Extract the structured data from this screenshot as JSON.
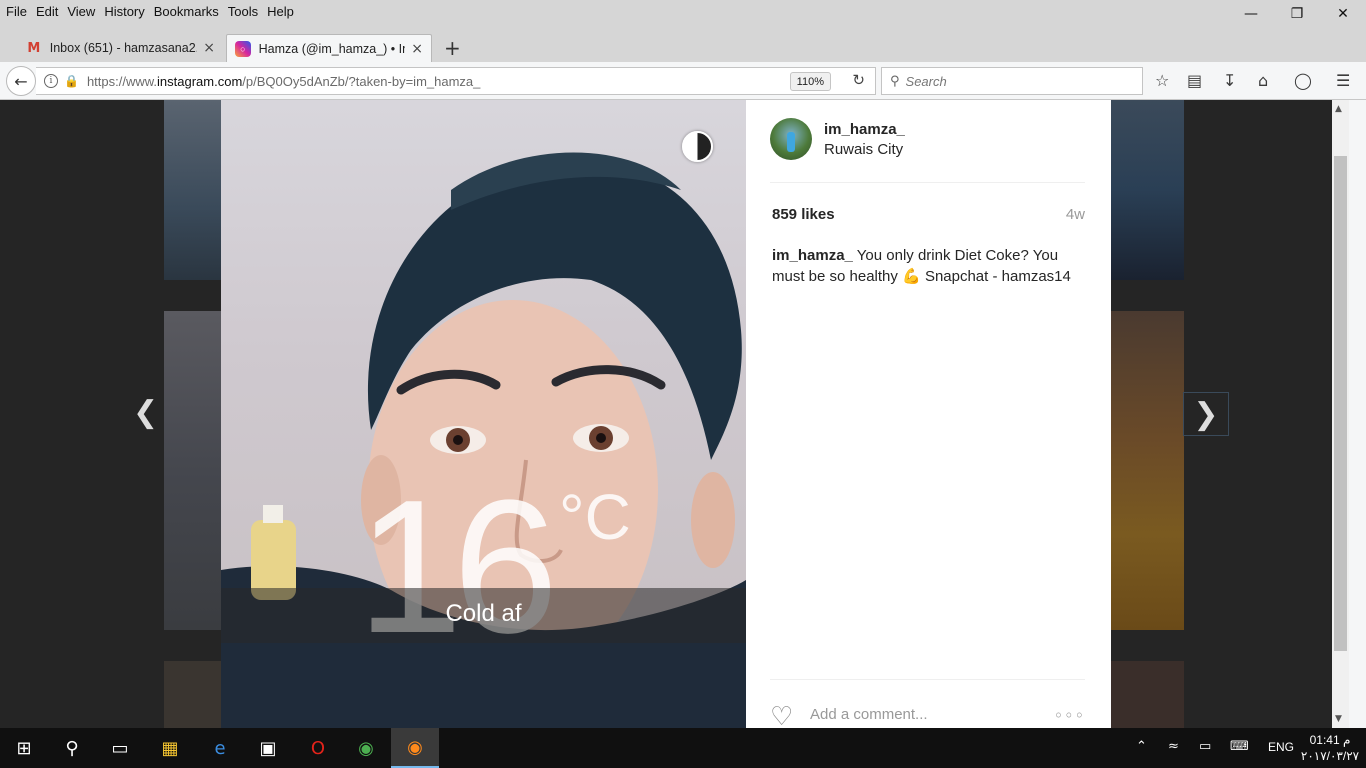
{
  "menubar": {
    "items": [
      "File",
      "Edit",
      "View",
      "History",
      "Bookmarks",
      "Tools",
      "Help"
    ]
  },
  "window_controls": {
    "minimize_icon": "minimize-icon",
    "restore_icon": "restore-icon",
    "close_icon": "close-icon"
  },
  "tabs": [
    {
      "title": "Inbox (651) - hamzasana2...",
      "icon": "gmail-icon"
    },
    {
      "title": "Hamza (@im_hamza_) • In...",
      "icon": "instagram-icon"
    }
  ],
  "navbar": {
    "url_prefix": "https://www.",
    "url_domain": "instagram.com",
    "url_path": "/p/BQ0Oy5dAnZb/?taken-by=im_hamza_",
    "zoom": "110%",
    "search_placeholder": "Search"
  },
  "photo": {
    "temperature": "16",
    "temperature_unit": "°C",
    "overlay_caption": "Cold af"
  },
  "post": {
    "username": "im_hamza_",
    "location": "Ruwais City",
    "likes": "859 likes",
    "time_ago": "4w",
    "caption_user": "im_hamza_",
    "caption_text_1": "You only drink Diet Coke? You must be so healthy",
    "caption_emoji": "💪",
    "caption_text_2": "Snapchat - hamzas14",
    "comment_placeholder": "Add a comment..."
  },
  "taskbar": {
    "language": "ENG",
    "time": "01:41 م",
    "date": "٢٠١٧/٠٣/٢٧"
  },
  "colors": {
    "instagram_text": "#262626",
    "muted_text": "#999999",
    "taskbar_bg": "#101010",
    "page_overlay_bg": "#252525"
  }
}
